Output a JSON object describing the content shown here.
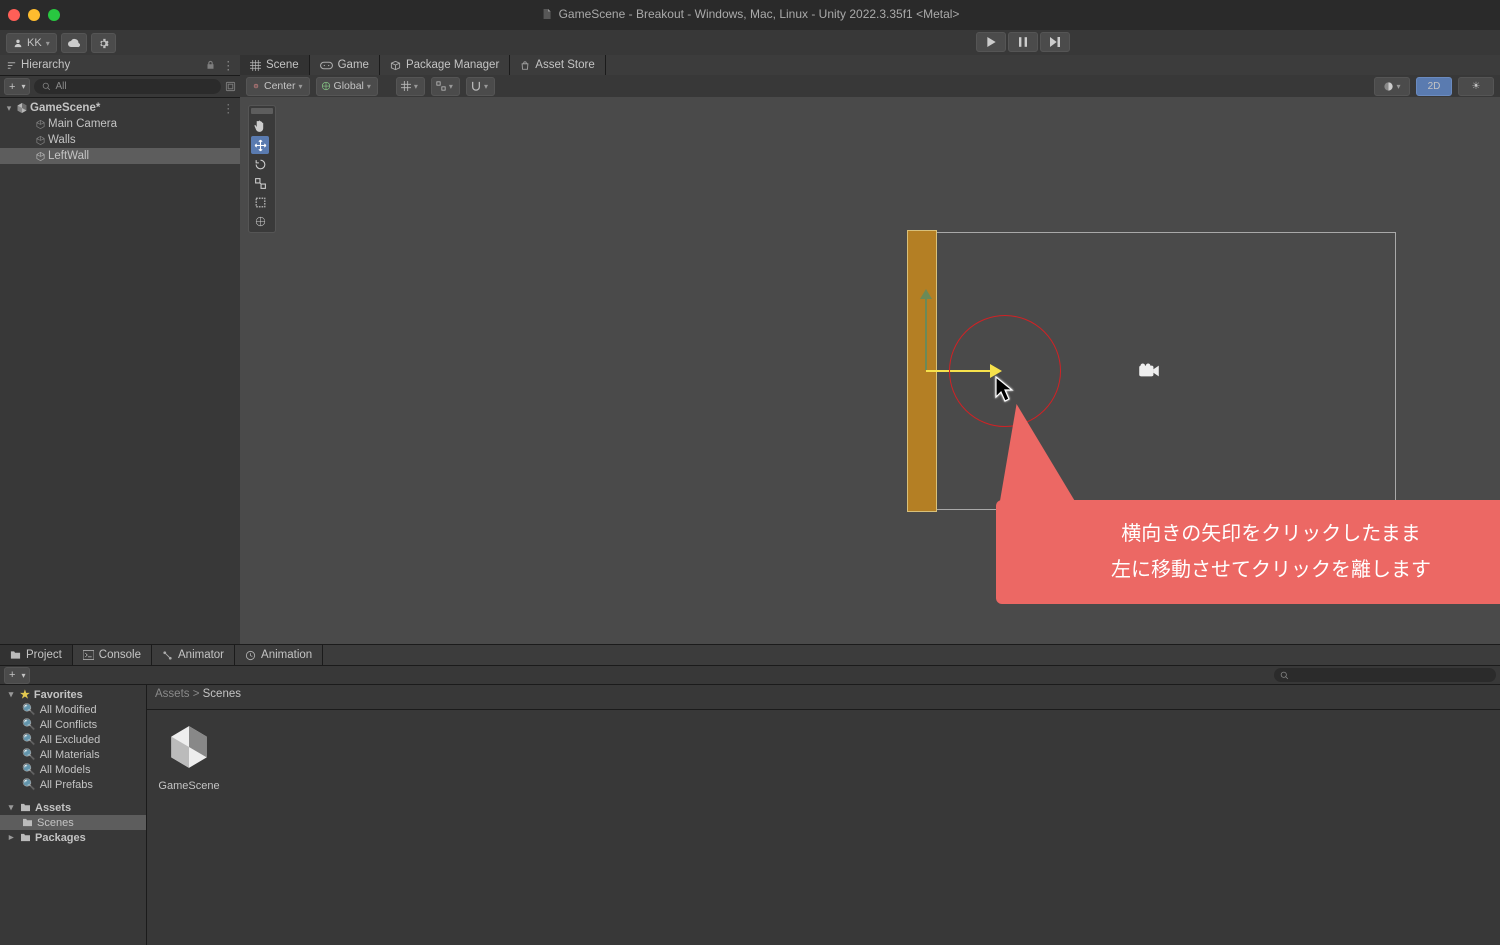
{
  "window": {
    "title": "GameScene - Breakout - Windows, Mac, Linux - Unity 2022.3.35f1 <Metal>"
  },
  "account": {
    "label": "KK"
  },
  "hierarchy": {
    "title": "Hierarchy",
    "search_placeholder": "All",
    "scene": "GameScene*",
    "items": [
      "Main Camera",
      "Walls",
      "LeftWall"
    ],
    "selected": "LeftWall"
  },
  "main_tabs": [
    {
      "label": "Scene",
      "icon": "grid"
    },
    {
      "label": "Game",
      "icon": "game"
    },
    {
      "label": "Package Manager",
      "icon": "package"
    },
    {
      "label": "Asset Store",
      "icon": "bag"
    }
  ],
  "scene_toolbar": {
    "pivot": "Center",
    "space": "Global",
    "mode2d": "2D"
  },
  "scene_tools": [
    "hand",
    "move",
    "rotate",
    "scale",
    "rect",
    "transform"
  ],
  "scene_tool_selected": "move",
  "callout": {
    "line1": "横向きの矢印をクリックしたまま",
    "line2": "左に移動させてクリックを離します"
  },
  "bottom_tabs": [
    {
      "label": "Project",
      "icon": "folder"
    },
    {
      "label": "Console",
      "icon": "console"
    },
    {
      "label": "Animator",
      "icon": "animator"
    },
    {
      "label": "Animation",
      "icon": "animation"
    }
  ],
  "favorites_header": "Favorites",
  "favorites": [
    "All Modified",
    "All Conflicts",
    "All Excluded",
    "All Materials",
    "All Models",
    "All Prefabs"
  ],
  "assets_header": "Assets",
  "assets_items": [
    "Scenes"
  ],
  "packages_header": "Packages",
  "breadcrumb": {
    "root": "Assets",
    "current": "Scenes"
  },
  "thumbs": [
    {
      "label": "GameScene"
    }
  ]
}
